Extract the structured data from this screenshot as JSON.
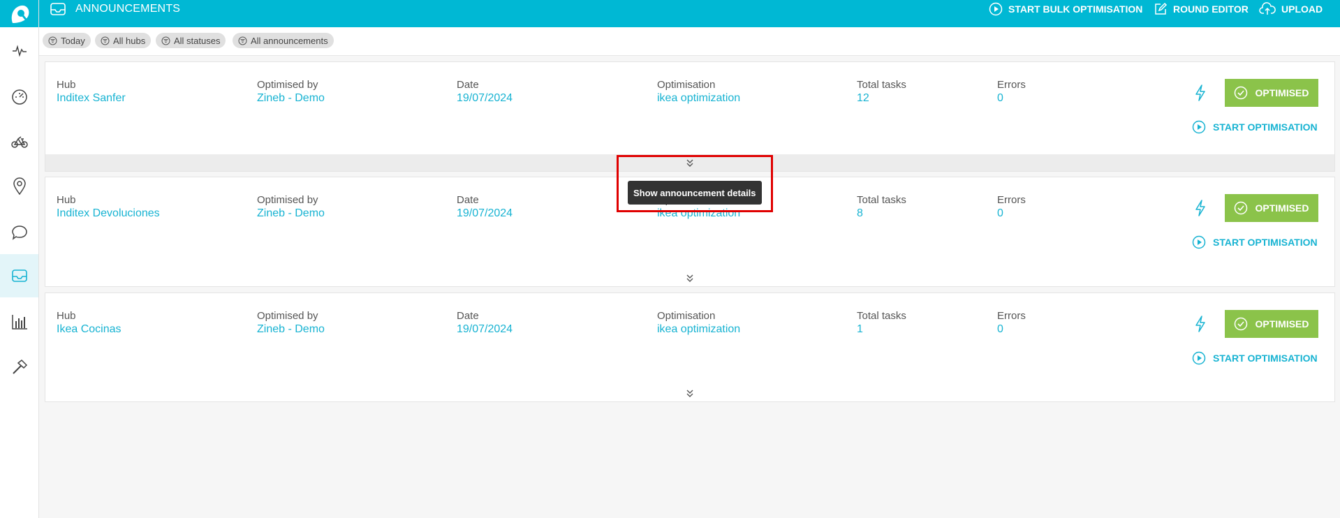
{
  "header": {
    "title": "ANNOUNCEMENTS",
    "actions": {
      "bulk": "START BULK OPTIMISATION",
      "editor": "ROUND EDITOR",
      "upload": "UPLOAD"
    }
  },
  "filters": [
    "Today",
    "All hubs",
    "All statuses",
    "All announcements"
  ],
  "labels": {
    "hub": "Hub",
    "optimised_by": "Optimised by",
    "date": "Date",
    "optimisation": "Optimisation",
    "total_tasks": "Total tasks",
    "errors": "Errors",
    "status": "OPTIMISED",
    "start": "START OPTIMISATION"
  },
  "announcements": [
    {
      "hub": "Inditex Sanfer",
      "optimised_by": "Zineb - Demo",
      "date": "19/07/2024",
      "optimisation": "ikea optimization",
      "total_tasks": "12",
      "errors": "0"
    },
    {
      "hub": "Inditex Devoluciones",
      "optimised_by": "Zineb - Demo",
      "date": "19/07/2024",
      "optimisation": "ikea optimization",
      "total_tasks": "8",
      "errors": "0"
    },
    {
      "hub": "Ikea Cocinas",
      "optimised_by": "Zineb - Demo",
      "date": "19/07/2024",
      "optimisation": "ikea optimization",
      "total_tasks": "1",
      "errors": "0"
    }
  ],
  "tooltip": "Show announcement details",
  "colors": {
    "accent": "#00b8d4",
    "link": "#17b3d2",
    "success": "#8bc34a"
  },
  "sidebar_icons": [
    "activity-icon",
    "dashboard-icon",
    "bicycle-icon",
    "location-pin-icon",
    "chat-icon",
    "inbox-icon",
    "bar-chart-icon",
    "hammer-icon"
  ]
}
